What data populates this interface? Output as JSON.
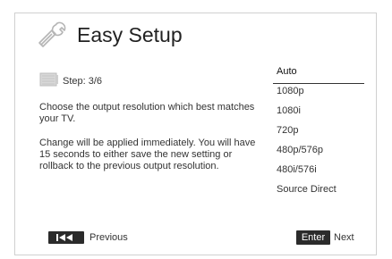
{
  "header": {
    "icon": "wrench-icon",
    "title": "Easy Setup"
  },
  "step": {
    "icon": "monitor-icon",
    "label": "Step: 3/6"
  },
  "instructions": {
    "paragraph1": "Choose the output resolution which best matches your TV.",
    "paragraph2": "Change will be applied immediately.  You will have 15 seconds to either save the new setting or rollback to the previous output resolution."
  },
  "options": {
    "selected": "Auto",
    "items": [
      "Auto",
      "1080p",
      "1080i",
      "720p",
      "480p/576p",
      "480i/576i",
      "Source Direct"
    ]
  },
  "footer": {
    "previous_icon": "skip-back-icon",
    "previous_label": "Previous",
    "enter_label": "Enter",
    "next_label": "Next"
  },
  "colors": {
    "button_bg": "#2b2b2b",
    "text": "#333333"
  }
}
